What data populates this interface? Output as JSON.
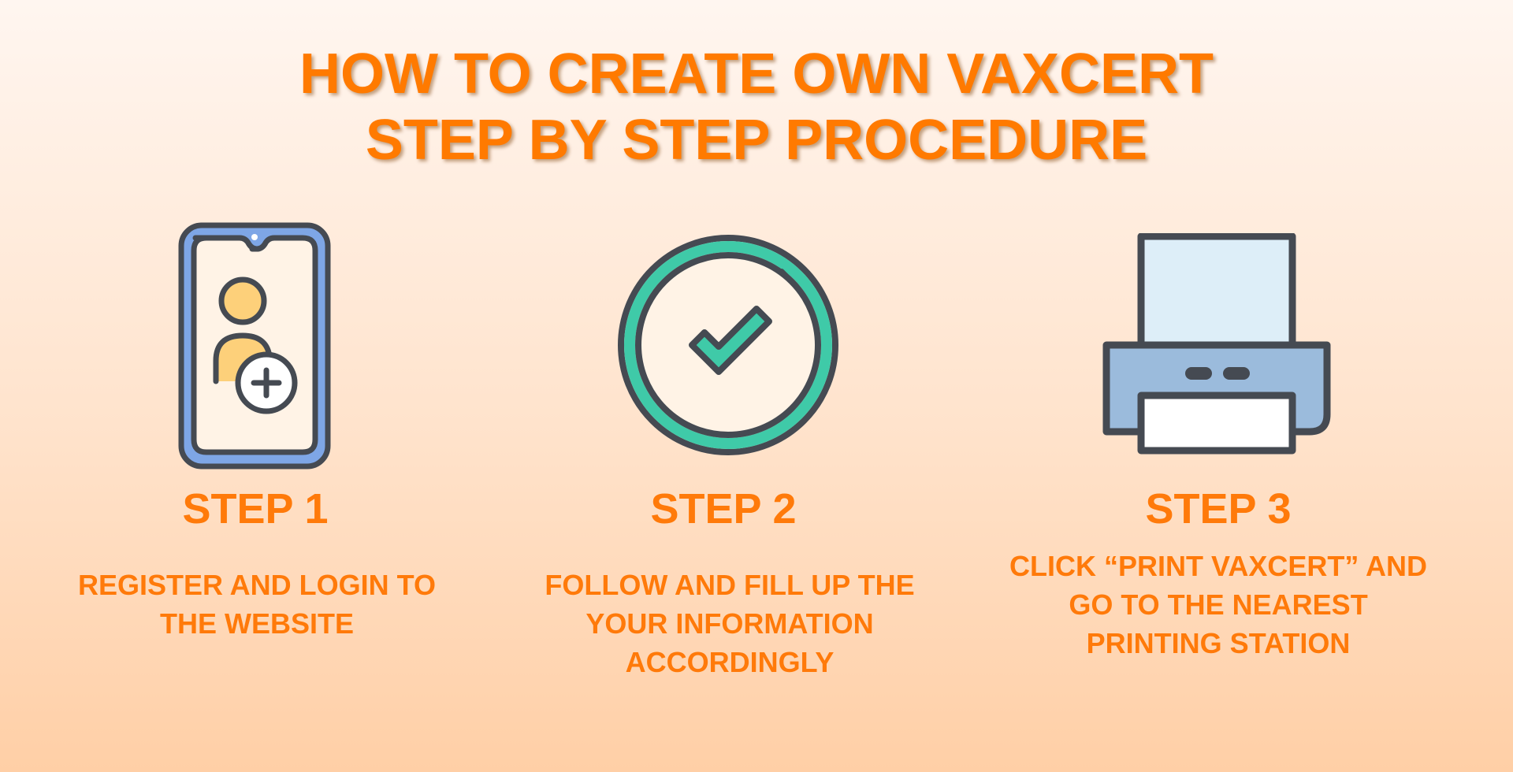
{
  "title": {
    "line1": "HOW TO CREATE OWN VAXCERT",
    "line2": "STEP BY STEP PROCEDURE"
  },
  "steps": [
    {
      "label": "STEP 1",
      "description_lines": [
        "REGISTER AND LOGIN TO",
        "THE WEBSITE"
      ],
      "icon": "smartphone-add-user-icon"
    },
    {
      "label": "STEP 2",
      "description_lines": [
        "FOLLOW AND FILL UP THE",
        "YOUR INFORMATION",
        "ACCORDINGLY"
      ],
      "icon": "check-circle-icon"
    },
    {
      "label": "STEP 3",
      "description_lines": [
        "CLICK “PRINT VAXCERT” AND",
        "GO TO THE NEAREST",
        "PRINTING STATION"
      ],
      "icon": "printer-icon"
    }
  ],
  "colors": {
    "accent": "#ff7a00",
    "outline": "#454a52",
    "phone_blue": "#7ea6e6",
    "user_yellow": "#fdd07a",
    "check_green": "#3fcaa8",
    "paper_light": "#ddeef8",
    "printer_body": "#9bbbdc"
  }
}
